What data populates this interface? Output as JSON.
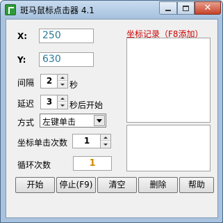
{
  "window": {
    "title": "斑马鼠标点击器 4.1",
    "close_glyph": "✕"
  },
  "coords": {
    "x_label": "X:",
    "x_value": "250",
    "y_label": "Y:",
    "y_value": "630"
  },
  "interval": {
    "label": "间隔",
    "value": "2",
    "unit": "秒"
  },
  "delay": {
    "label": "延迟",
    "value": "3",
    "unit": "秒后开始"
  },
  "mode": {
    "label": "方式",
    "selected": "左键单击"
  },
  "clicks_per_coord": {
    "label": "坐标单击次数",
    "value": "1"
  },
  "loop_count": {
    "label": "循环次数",
    "value": "1"
  },
  "record": {
    "title": "坐标记录（F8添加）"
  },
  "buttons": {
    "start": "开始",
    "stop": "停止(F9)",
    "clear": "清空",
    "delete": "删除",
    "help": "帮助"
  },
  "colors": {
    "title_red": "#cc0000",
    "coord_value": "#2a7a9a",
    "loop_value": "#d08a00"
  }
}
